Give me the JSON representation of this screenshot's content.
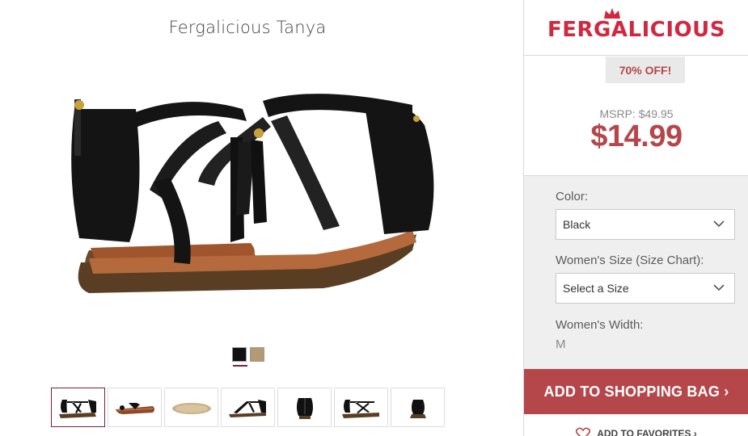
{
  "product": {
    "title": "Fergalicious Tanya",
    "main_image_icon": "sandal-product-image",
    "swatches": [
      {
        "name": "black",
        "color": "#111111"
      },
      {
        "name": "tan",
        "color": "#b39a73"
      }
    ],
    "thumbnails": [
      {
        "icon": "sandal-thumb-side"
      },
      {
        "icon": "sandal-thumb-side-flat"
      },
      {
        "icon": "sandal-thumb-sole"
      },
      {
        "icon": "sandal-thumb-side-2"
      },
      {
        "icon": "sandal-thumb-back"
      },
      {
        "icon": "sandal-thumb-front"
      },
      {
        "icon": "sandal-thumb-heel"
      }
    ]
  },
  "brand": {
    "logo_text": "FERGALICIOUS",
    "logo_color": "#d0283f"
  },
  "pricing": {
    "discount_badge": "70% OFF!",
    "msrp": "MSRP: $49.95",
    "price": "$14.99",
    "accent_color": "#b5464a"
  },
  "options": {
    "color_label": "Color:",
    "color_value": "Black",
    "size_label": "Women's Size (Size Chart):",
    "size_value": "Select a Size",
    "width_label": "Women's Width:",
    "width_value": "M"
  },
  "actions": {
    "add_to_bag": "ADD TO SHOPPING BAG ›",
    "add_to_favorites": "ADD TO FAVORITES ›"
  }
}
